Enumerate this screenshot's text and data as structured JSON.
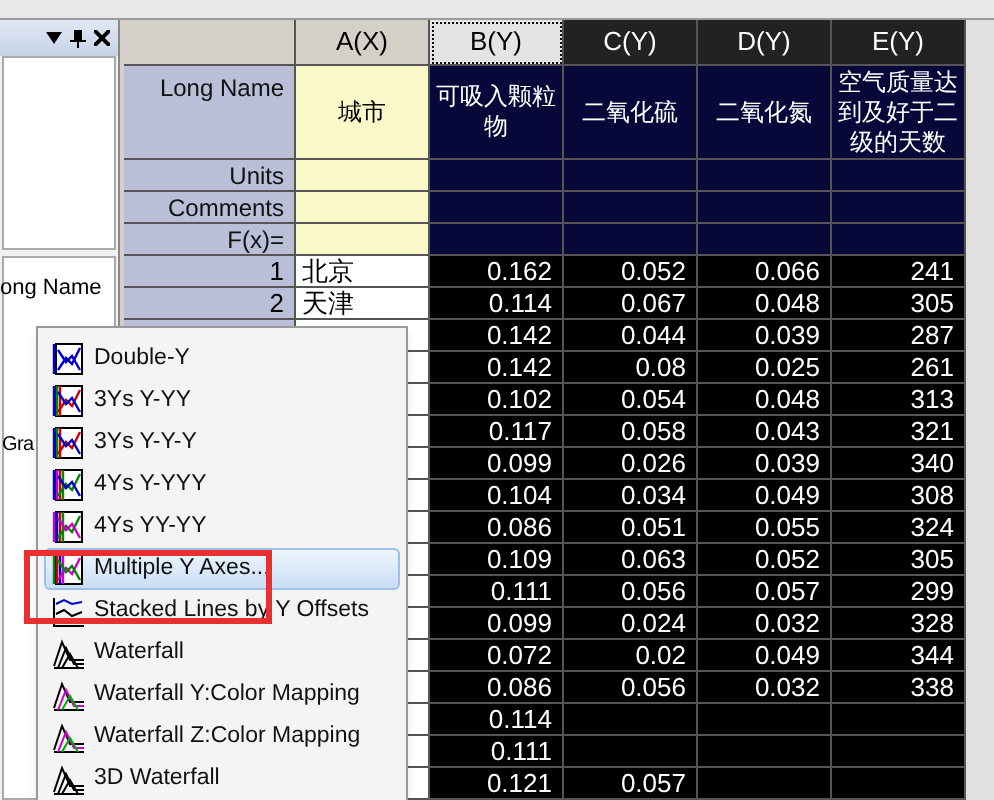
{
  "left_panel": {
    "lower_pane_texts": [
      "ong Name",
      "Gra"
    ]
  },
  "sheet": {
    "columns": [
      {
        "label": "A(X)",
        "selected": false,
        "active": false,
        "long_name": "城市"
      },
      {
        "label": "B(Y)",
        "selected": true,
        "active": true,
        "long_name": "可吸入颗粒物"
      },
      {
        "label": "C(Y)",
        "selected": true,
        "active": false,
        "long_name": "二氧化硫"
      },
      {
        "label": "D(Y)",
        "selected": true,
        "active": false,
        "long_name": "二氧化氮"
      },
      {
        "label": "E(Y)",
        "selected": true,
        "active": false,
        "long_name": "空气质量达到及好于二级的天数"
      }
    ],
    "label_rows": [
      "Long Name",
      "Units",
      "Comments",
      "F(x)="
    ],
    "rows": [
      {
        "number": "1",
        "city": "北京",
        "values": [
          "0.162",
          "0.052",
          "0.066",
          "241"
        ]
      },
      {
        "number": "2",
        "city": "天津",
        "values": [
          "0.114",
          "0.067",
          "0.048",
          "305"
        ]
      },
      {
        "values": [
          "0.142",
          "0.044",
          "0.039",
          "287"
        ]
      },
      {
        "values": [
          "0.142",
          "0.08",
          "0.025",
          "261"
        ]
      },
      {
        "values": [
          "0.102",
          "0.054",
          "0.048",
          "313"
        ]
      },
      {
        "values": [
          "0.117",
          "0.058",
          "0.043",
          "321"
        ]
      },
      {
        "values": [
          "0.099",
          "0.026",
          "0.039",
          "340"
        ]
      },
      {
        "values": [
          "0.104",
          "0.034",
          "0.049",
          "308"
        ]
      },
      {
        "values": [
          "0.086",
          "0.051",
          "0.055",
          "324"
        ]
      },
      {
        "values": [
          "0.109",
          "0.063",
          "0.052",
          "305"
        ]
      },
      {
        "values": [
          "0.111",
          "0.056",
          "0.057",
          "299"
        ]
      },
      {
        "values": [
          "0.099",
          "0.024",
          "0.032",
          "328"
        ]
      },
      {
        "values": [
          "0.072",
          "0.02",
          "0.049",
          "344"
        ]
      },
      {
        "values": [
          "0.086",
          "0.056",
          "0.032",
          "338"
        ]
      },
      {
        "values": [
          "0.114"
        ]
      },
      {
        "values": [
          "0.111"
        ]
      },
      {
        "values": [
          "0.121",
          "0.057"
        ]
      }
    ]
  },
  "menu": {
    "items": [
      {
        "label": "Double-Y",
        "selected": false
      },
      {
        "label": "3Ys Y-YY",
        "selected": false
      },
      {
        "label": "3Ys Y-Y-Y",
        "selected": false
      },
      {
        "label": "4Ys Y-YYY",
        "selected": false
      },
      {
        "label": "4Ys YY-YY",
        "selected": false
      },
      {
        "label": "Multiple Y Axes...",
        "selected": true
      },
      {
        "label": "Stacked Lines by Y Offsets",
        "selected": false
      },
      {
        "label": "Waterfall",
        "selected": false
      },
      {
        "label": "Waterfall Y:Color Mapping",
        "selected": false
      },
      {
        "label": "Waterfall Z:Color Mapping",
        "selected": false
      },
      {
        "label": "3D Waterfall",
        "selected": false
      }
    ]
  }
}
